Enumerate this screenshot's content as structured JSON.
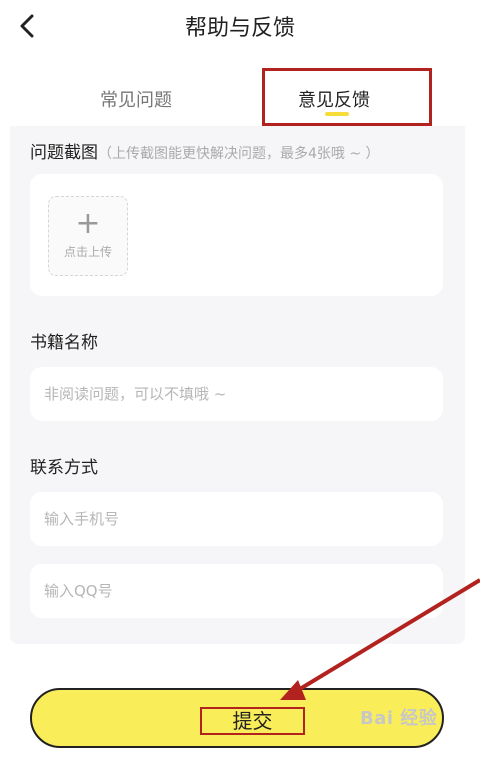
{
  "header": {
    "title": "帮助与反馈",
    "back_icon": "chevron-left-icon"
  },
  "tabs": [
    {
      "label": "常见问题",
      "active": false
    },
    {
      "label": "意见反馈",
      "active": true
    }
  ],
  "screenshot_section": {
    "title": "问题截图",
    "hint": "（上传截图能更快解决问题，最多4张哦 ~ ）",
    "upload_label": "点击上传",
    "upload_icon": "plus-icon"
  },
  "book_section": {
    "title": "书籍名称",
    "placeholder": "非阅读问题，可以不填哦 ~"
  },
  "contact_section": {
    "title": "联系方式",
    "phone_placeholder": "输入手机号",
    "qq_placeholder": "输入QQ号"
  },
  "submit": {
    "label": "提交"
  },
  "watermark": {
    "text": "Bai 经验"
  },
  "colors": {
    "accent": "#f9ee5a",
    "annotation": "#b2231f",
    "panel": "#f6f6f8"
  }
}
